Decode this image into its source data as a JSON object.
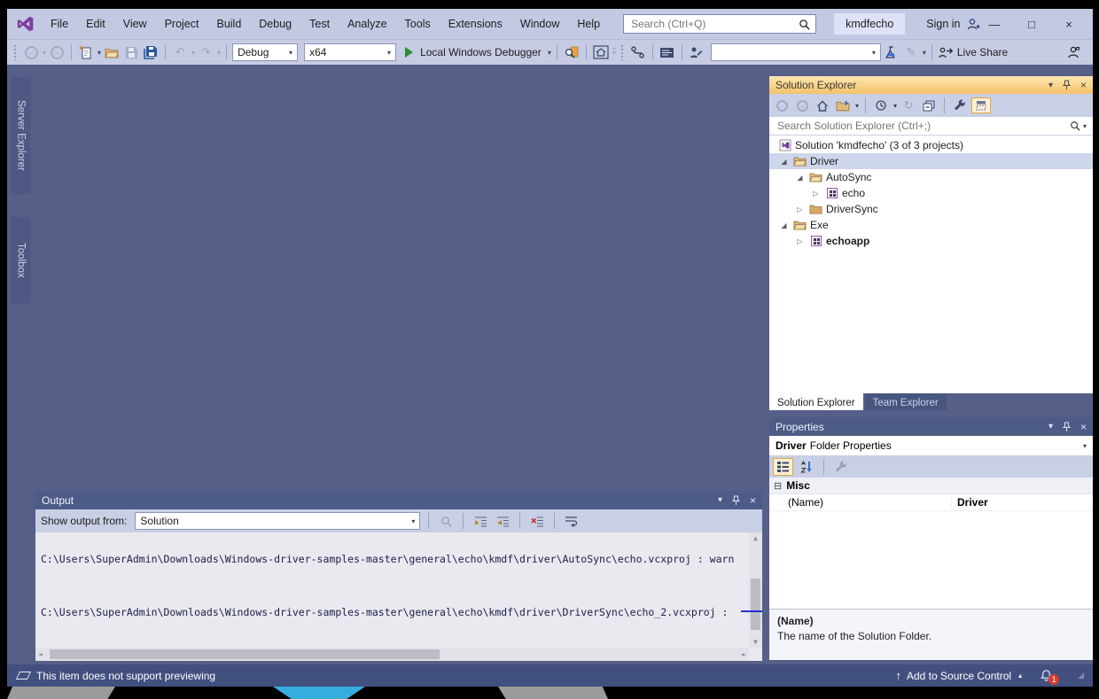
{
  "window": {
    "app_title": "kmdfecho",
    "sign_in_label": "Sign in",
    "search_placeholder": "Search (Ctrl+Q)"
  },
  "menu": {
    "items": [
      "File",
      "Edit",
      "View",
      "Project",
      "Build",
      "Debug",
      "Test",
      "Analyze",
      "Tools",
      "Extensions",
      "Window",
      "Help"
    ]
  },
  "toolbar": {
    "configuration": "Debug",
    "platform": "x64",
    "run_label": "Local Windows Debugger",
    "live_share_label": "Live Share"
  },
  "left_tabs": {
    "items": [
      "Server Explorer",
      "Toolbox"
    ]
  },
  "solution_explorer": {
    "title": "Solution Explorer",
    "search_placeholder": "Search Solution Explorer (Ctrl+;)",
    "tree": [
      {
        "exp": "",
        "label": "Solution 'kmdfecho' (3 of 3 projects)"
      },
      {
        "exp": "◢",
        "label": "Driver"
      },
      {
        "exp": "◢",
        "label": "AutoSync"
      },
      {
        "exp": "▷",
        "label": "echo"
      },
      {
        "exp": "▷",
        "label": "DriverSync"
      },
      {
        "exp": "◢",
        "label": "Exe"
      },
      {
        "exp": "▷",
        "label": "echoapp"
      }
    ],
    "tabs": [
      "Solution Explorer",
      "Team Explorer"
    ]
  },
  "properties": {
    "title": "Properties",
    "object_name": "Driver",
    "object_type": "Folder Properties",
    "category": "Misc",
    "rows": [
      {
        "name": "(Name)",
        "value": "Driver"
      }
    ],
    "description_title": "(Name)",
    "description_text": "The name of the Solution Folder."
  },
  "output": {
    "title": "Output",
    "show_from_label": "Show output from:",
    "source": "Solution",
    "lines": [
      "C:\\Users\\SuperAdmin\\Downloads\\Windows-driver-samples-master\\general\\echo\\kmdf\\driver\\AutoSync\\echo.vcxproj : warn",
      "C:\\Users\\SuperAdmin\\Downloads\\Windows-driver-samples-master\\general\\echo\\kmdf\\driver\\DriverSync\\echo_2.vcxproj :"
    ]
  },
  "status_bar": {
    "message": "This item does not support previewing",
    "source_control_label": "Add to Source Control",
    "notification_count": "1"
  },
  "glyphs": {
    "caret_down": "▾",
    "caret_up": "▴",
    "back": "←",
    "forward": "→",
    "undo": "↶",
    "redo": "↷",
    "refresh": "↻",
    "minimize": "—",
    "maximize": "□",
    "close": "×",
    "minus_box": "⊟",
    "pencil": "✎",
    "up_arrow": "↑",
    "scroll_up": "▲",
    "scroll_down": "▼",
    "scroll_left": "◄",
    "scroll_right": "►",
    "grip": "◢"
  },
  "colors": {
    "accent_orange_titlebar": "#f3c269",
    "docwell_background": "#565f88",
    "statusbar_background": "#42507f",
    "notification_badge": "#d83b2e",
    "run_green": "#2f8b33",
    "vs_purple": "#7b3fa0"
  }
}
